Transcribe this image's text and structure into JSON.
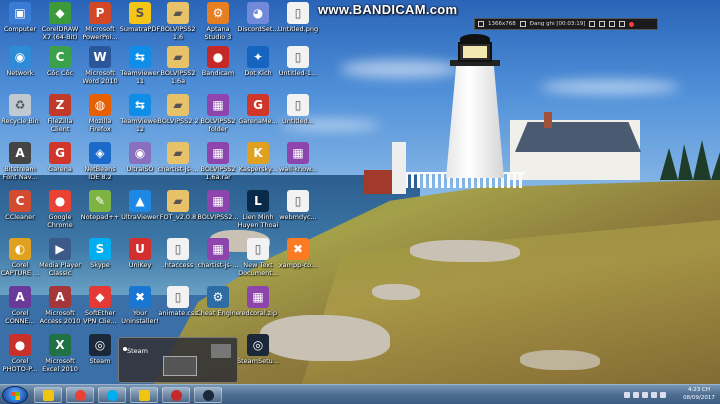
{
  "watermark": {
    "text": "www.BANDICAM.com"
  },
  "recording_toolbar": {
    "resolution": "1366x768",
    "status": "Đang ghi [00:03:19]"
  },
  "desktop_icons": [
    {
      "name": "computer",
      "label": "Computer",
      "icon": "computer-icon",
      "color": "#3a7bd5"
    },
    {
      "name": "network",
      "label": "Network",
      "icon": "network-icon",
      "color": "#2e8bd8"
    },
    {
      "name": "recycle-bin",
      "label": "Recycle Bin",
      "icon": "recycle-bin-icon",
      "color": "#c0c8d0"
    },
    {
      "name": "bitstream-font-nav",
      "label": "Bitstream Font Nav...",
      "icon": "font-icon",
      "color": "#444444"
    },
    {
      "name": "ccleaner",
      "label": "CCleaner",
      "icon": "ccleaner-icon",
      "color": "#d24a2f"
    },
    {
      "name": "corel-capture",
      "label": "Corel CAPTURE ...",
      "icon": "corel-capture-icon",
      "color": "#e0a020"
    },
    {
      "name": "corel-connect",
      "label": "Corel CONNE...",
      "icon": "corel-connect-icon",
      "color": "#6a3a9a"
    },
    {
      "name": "corel-photo-paint",
      "label": "Corel PHOTO-P...",
      "icon": "corel-photo-icon",
      "color": "#c8302a"
    },
    {
      "name": "coreldraw",
      "label": "CorelDRAW X7 (64-Bit)",
      "icon": "coreldraw-icon",
      "color": "#3d9a3a"
    },
    {
      "name": "coc-coc",
      "label": "Cốc Cốc",
      "icon": "coccoc-icon",
      "color": "#3aa04a"
    },
    {
      "name": "filezilla",
      "label": "FileZilla Client",
      "icon": "filezilla-icon",
      "color": "#c0392b"
    },
    {
      "name": "garena",
      "label": "Garena",
      "icon": "garena-icon",
      "color": "#d0362a"
    },
    {
      "name": "google-chrome",
      "label": "Google Chrome",
      "icon": "chrome-icon",
      "color": "#e94235"
    },
    {
      "name": "media-player-classic",
      "label": "Media Player Classic",
      "icon": "mpc-icon",
      "color": "#3b5a8a"
    },
    {
      "name": "access-2010",
      "label": "Microsoft Access 2010",
      "icon": "access-icon",
      "color": "#a4373a"
    },
    {
      "name": "excel-2010",
      "label": "Microsoft Excel 2010",
      "icon": "excel-icon",
      "color": "#207245"
    },
    {
      "name": "powerpoint",
      "label": "Microsoft PowerPoi...",
      "icon": "powerpoint-icon",
      "color": "#d24726"
    },
    {
      "name": "word-2010",
      "label": "Microsoft Word 2010",
      "icon": "word-icon",
      "color": "#2b579a"
    },
    {
      "name": "firefox",
      "label": "Mozilla Firefox",
      "icon": "firefox-icon",
      "color": "#e66000"
    },
    {
      "name": "netbeans",
      "label": "NetBeans IDE 8.2",
      "icon": "netbeans-icon",
      "color": "#1b6ac9"
    },
    {
      "name": "notepad-plus",
      "label": "Notepad++",
      "icon": "notepad-icon",
      "color": "#7cb342"
    },
    {
      "name": "skype",
      "label": "Skype",
      "icon": "skype-icon",
      "color": "#00aff0"
    },
    {
      "name": "softether",
      "label": "SoftEther VPN Clie...",
      "icon": "softether-icon",
      "color": "#e53935"
    },
    {
      "name": "steam",
      "label": "Steam",
      "icon": "steam-icon",
      "color": "#1b2838"
    },
    {
      "name": "sumatrapdf",
      "label": "SumatraPDF",
      "icon": "sumatra-icon",
      "color": "#f5c518"
    },
    {
      "name": "teamviewer-11",
      "label": "Teamviewer 11",
      "icon": "teamviewer-icon",
      "color": "#0e8ee9"
    },
    {
      "name": "teamviewer-12",
      "label": "TeamViewer 12",
      "icon": "teamviewer-icon",
      "color": "#0e8ee9"
    },
    {
      "name": "ultraiso",
      "label": "UltraISO",
      "icon": "ultraiso-icon",
      "color": "#8a6fbf"
    },
    {
      "name": "ultraviewer",
      "label": "UltraViewer",
      "icon": "ultraviewer-icon",
      "color": "#1e88e5"
    },
    {
      "name": "unikey",
      "label": "UniKey",
      "icon": "unikey-icon",
      "color": "#d32f2f"
    },
    {
      "name": "your-uninstaller",
      "label": "Your Uninstaller!",
      "icon": "uninstaller-icon",
      "color": "#1976d2"
    },
    {
      "name": "bolvipss2-16",
      "label": "BOLVIPSS2 1.6",
      "icon": "folder-icon",
      "color": "#e8c268"
    },
    {
      "name": "bolvipss2-16a",
      "label": "BOLVIPSS2 1.6a",
      "icon": "folder-icon",
      "color": "#e8c268"
    },
    {
      "name": "bolvipss2-2",
      "label": "BOLVIPSS2 2",
      "icon": "folder-icon",
      "color": "#e8c268"
    },
    {
      "name": "chartist-js",
      "label": "chartist-js-...",
      "icon": "folder-icon",
      "color": "#e8c268"
    },
    {
      "name": "fot-208",
      "label": "FOT_v2.0.8",
      "icon": "folder-icon",
      "color": "#e8c268"
    },
    {
      "name": "htaccess",
      "label": ".htaccess",
      "icon": "file-icon",
      "color": "#f2f2f2"
    },
    {
      "name": "animate-css",
      "label": "animate.css",
      "icon": "css-file-icon",
      "color": "#f2f2f2"
    },
    {
      "name": "aptana-studio",
      "label": "Aptana Studio 3",
      "icon": "aptana-icon",
      "color": "#e67e22"
    },
    {
      "name": "bandicam",
      "label": "Bandicam",
      "icon": "bandicam-icon",
      "color": "#c62828"
    },
    {
      "name": "bolvipss2-folder",
      "label": "BOLVIPSS2 folder",
      "icon": "winrar-icon",
      "color": "#8e44ad"
    },
    {
      "name": "bolvipss2-16a-rar",
      "label": "BOLVIPSS2 1.6a.rar",
      "icon": "winrar-icon",
      "color": "#8e44ad"
    },
    {
      "name": "bolvipss2-rar",
      "label": "BOLVIPSS2...",
      "icon": "winrar-icon",
      "color": "#8e44ad"
    },
    {
      "name": "chartist-js-2",
      "label": "chartist-js-...",
      "icon": "winrar-icon",
      "color": "#8e44ad"
    },
    {
      "name": "cheat-engine",
      "label": "Cheat Engine",
      "icon": "cheat-engine-icon",
      "color": "#2e6da4"
    },
    {
      "name": "discord-setup",
      "label": "DiscordSet...",
      "icon": "discord-icon",
      "color": "#7289da"
    },
    {
      "name": "dot-kich",
      "label": "Dot Kich",
      "icon": "dotkich-icon",
      "color": "#1565c0"
    },
    {
      "name": "garena-messenger",
      "label": "GarenaMe...",
      "icon": "garena-icon",
      "color": "#d0362a"
    },
    {
      "name": "kaspersky",
      "label": "Kaspersky...",
      "icon": "kaspersky-icon",
      "color": "#e0a020"
    },
    {
      "name": "lien-minh",
      "label": "Lien Minh Huyen Thoai",
      "icon": "lol-icon",
      "color": "#0a2a4a"
    },
    {
      "name": "new-text-doc",
      "label": "New Text Document...",
      "icon": "text-file-icon",
      "color": "#f2f2f2"
    },
    {
      "name": "redcoral-zip",
      "label": "redcoral.zip",
      "icon": "winrar-icon",
      "color": "#8e44ad"
    },
    {
      "name": "steam-setup",
      "label": "SteamSetu...",
      "icon": "steam-icon",
      "color": "#1b2838"
    },
    {
      "name": "untitled-png",
      "label": "Untitled.png",
      "icon": "image-file-icon",
      "color": "#f2f2f2"
    },
    {
      "name": "untitled-1",
      "label": "Untitled-1...",
      "icon": "image-file-icon",
      "color": "#f2f2f2"
    },
    {
      "name": "untitled-2",
      "label": "Untitled...",
      "icon": "image-file-icon",
      "color": "#f2f2f2"
    },
    {
      "name": "wall-know",
      "label": "wall-know...",
      "icon": "winrar-icon",
      "color": "#8e44ad"
    },
    {
      "name": "webmdyc",
      "label": "webmdyc...",
      "icon": "text-file-icon",
      "color": "#f2f2f2"
    },
    {
      "name": "xampp",
      "label": "xampp-co...",
      "icon": "xampp-icon",
      "color": "#fb7a24"
    }
  ],
  "steam_popup": {
    "title": "Steam"
  },
  "taskbar": {
    "pinned": [
      {
        "name": "explorer",
        "icon": "folder-icon",
        "color": "#f1c40f"
      },
      {
        "name": "chrome",
        "icon": "chrome-icon",
        "color": "#e94235"
      },
      {
        "name": "skype",
        "icon": "skype-icon",
        "color": "#00aff0"
      },
      {
        "name": "folder",
        "icon": "folder-icon",
        "color": "#f1c40f"
      },
      {
        "name": "bandicam",
        "icon": "bandicam-icon",
        "color": "#c62828"
      },
      {
        "name": "steam",
        "icon": "steam-icon",
        "color": "#1b2838"
      }
    ],
    "time": "4:23 CH",
    "date": "08/09/2017"
  }
}
